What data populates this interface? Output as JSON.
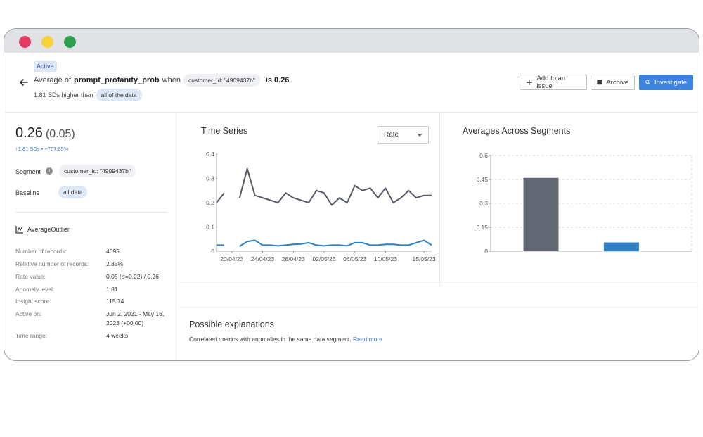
{
  "window": {
    "buttons": [
      "close",
      "minimize",
      "maximize"
    ]
  },
  "header": {
    "status_badge": "Active",
    "prefix": "Average of",
    "metric": "prompt_profanity_prob",
    "when": "when",
    "segment_chip": "customer_id: \"4909437b\"",
    "is_value": "is 0.26",
    "sub_prefix": "1.81 SDs higher than",
    "baseline_chip": "all of the data",
    "actions": {
      "add": "Add to an issue",
      "archive": "Archive",
      "investigate": "Investigate"
    },
    "icons": {
      "back": "arrow-left-icon",
      "add": "plus-icon",
      "archive": "archive-icon",
      "investigate": "search-icon"
    }
  },
  "summary": {
    "value": "0.26",
    "value_paren": "(0.05)",
    "delta": "↑1.81 SDs • +767.85%",
    "segment_label": "Segment",
    "segment_value": "customer_id: \"4909437b\"",
    "baseline_label": "Baseline",
    "baseline_value": "all data",
    "outlier_type": "AverageOutlier",
    "details": [
      {
        "key": "Number of records:",
        "value": "4095"
      },
      {
        "key": "Relative number of records:",
        "value": "2.85%"
      },
      {
        "key": "Rate value:",
        "value": "0.05 (σ=0.22) / 0.26"
      },
      {
        "key": "Anomaly level:",
        "value": "1.81"
      },
      {
        "key": "Insight score:",
        "value": "115.74"
      },
      {
        "key": "Active on:",
        "value": "Jun 2, 2021 - May 16, 2023 (+00:00)"
      },
      {
        "key": "Time range:",
        "value": "4 weeks"
      }
    ]
  },
  "time_series": {
    "title": "Time Series",
    "select_value": "Rate",
    "x_ticks": [
      "20/04/23",
      "24/04/23",
      "28/04/23",
      "02/05/23",
      "06/05/23",
      "10/05/23",
      "15/05/23"
    ],
    "y_ticks": [
      "0.4",
      "0.3",
      "0.2",
      "0.1",
      "0"
    ]
  },
  "averages": {
    "title": "Averages Across Segments",
    "y_ticks": [
      "0.6",
      "0.45",
      "0.3",
      "0.15",
      "0"
    ]
  },
  "explanations": {
    "title": "Possible explanations",
    "text": "Correlated metrics with anomalies in the same data segment.",
    "link": "Read more"
  },
  "colors": {
    "accent": "#3d84e0",
    "series_gray": "#555a66",
    "series_blue": "#2f7fc4",
    "bar_gray": "#636774",
    "bar_blue": "#2f7fc4"
  },
  "chart_data": [
    {
      "type": "line",
      "x": [
        "18/04/23",
        "19/04/23",
        "20/04/23",
        "21/04/23",
        "22/04/23",
        "23/04/23",
        "24/04/23",
        "25/04/23",
        "26/04/23",
        "27/04/23",
        "28/04/23",
        "29/04/23",
        "30/04/23",
        "01/05/23",
        "02/05/23",
        "03/05/23",
        "04/05/23",
        "05/05/23",
        "06/05/23",
        "07/05/23",
        "08/05/23",
        "09/05/23",
        "10/05/23",
        "11/05/23",
        "12/05/23",
        "13/05/23",
        "14/05/23",
        "15/05/23",
        "16/05/23"
      ],
      "series": [
        {
          "values": [
            0.2,
            0.24,
            null,
            0.22,
            0.34,
            0.23,
            0.22,
            0.21,
            0.2,
            0.24,
            0.22,
            0.21,
            0.2,
            0.25,
            0.24,
            0.19,
            0.22,
            0.2,
            0.27,
            0.25,
            0.26,
            0.22,
            0.26,
            0.2,
            0.22,
            0.25,
            0.22,
            0.23,
            0.23
          ]
        },
        {
          "values": [
            0.025,
            0.025,
            null,
            0.02,
            0.04,
            0.045,
            0.025,
            0.025,
            0.022,
            0.025,
            0.028,
            0.03,
            0.035,
            0.025,
            0.022,
            0.025,
            0.025,
            0.022,
            0.035,
            0.035,
            0.025,
            0.025,
            0.028,
            0.028,
            0.025,
            0.025,
            0.035,
            0.045,
            0.025
          ]
        }
      ],
      "ylim": [
        0,
        0.4
      ]
    },
    {
      "type": "bar",
      "categories": [
        "",
        ""
      ],
      "values": [
        0.46,
        0.055
      ],
      "ylim": [
        0,
        0.6
      ],
      "grid": true
    }
  ]
}
